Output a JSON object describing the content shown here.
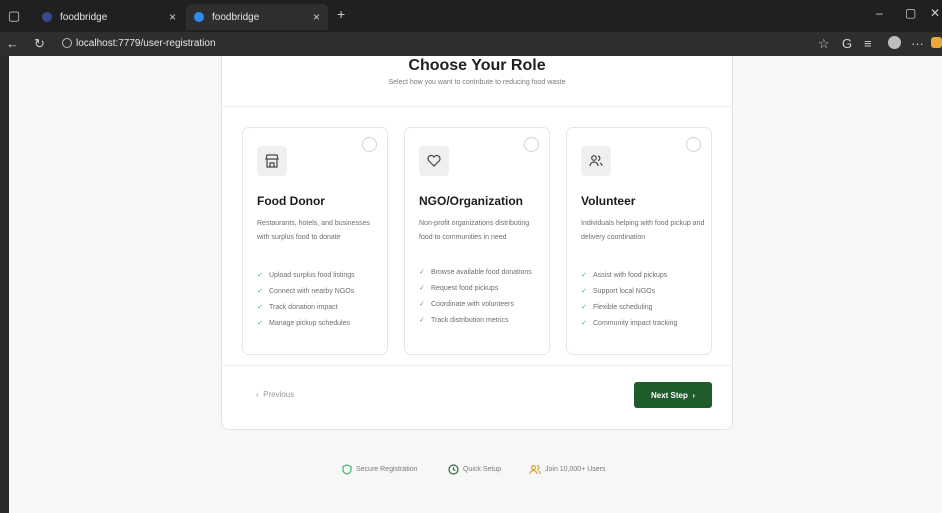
{
  "browser": {
    "tabs": [
      {
        "label": "foodbridge",
        "close": "×"
      },
      {
        "label": "foodbridge",
        "close": "×"
      }
    ],
    "new_tab": "+",
    "url": "localhost:7779/user-registration",
    "window_controls": {
      "minimize": "–",
      "maximize": "▢",
      "close": "✕"
    }
  },
  "page": {
    "title": "Choose Your Role",
    "subtitle": "Select how you want to contribute to reducing food waste",
    "roles": [
      {
        "icon": "store-icon",
        "title": "Food Donor",
        "description": "Restaurants, hotels, and businesses with surplus food to donate",
        "features": [
          "Upload surplus food listings",
          "Connect with nearby NGOs",
          "Track donation impact",
          "Manage pickup schedules"
        ]
      },
      {
        "icon": "heart-icon",
        "title": "NGO/Organization",
        "description": "Non-profit organizations distributing food to communities in need",
        "features": [
          "Browse available food donations",
          "Request food pickups",
          "Coordinate with volunteers",
          "Track distribution metrics"
        ]
      },
      {
        "icon": "users-icon",
        "title": "Volunteer",
        "description": "Individuals helping with food pickup and delivery coordination",
        "features": [
          "Assist with food pickups",
          "Support local NGOs",
          "Flexible scheduling",
          "Community impact tracking"
        ]
      }
    ],
    "previous_label": "Previous",
    "next_label": "Next Step",
    "trust": [
      {
        "icon": "shield-icon",
        "label": "Secure Registration",
        "color": "#4caf6d"
      },
      {
        "icon": "clock-icon",
        "label": "Quick Setup",
        "color": "#2f6a3a"
      },
      {
        "icon": "users-icon",
        "label": "Join 10,000+ Users",
        "color": "#e0a13a"
      }
    ]
  },
  "colors": {
    "accent": "#1f5c2b",
    "check": "#4caf6d"
  }
}
